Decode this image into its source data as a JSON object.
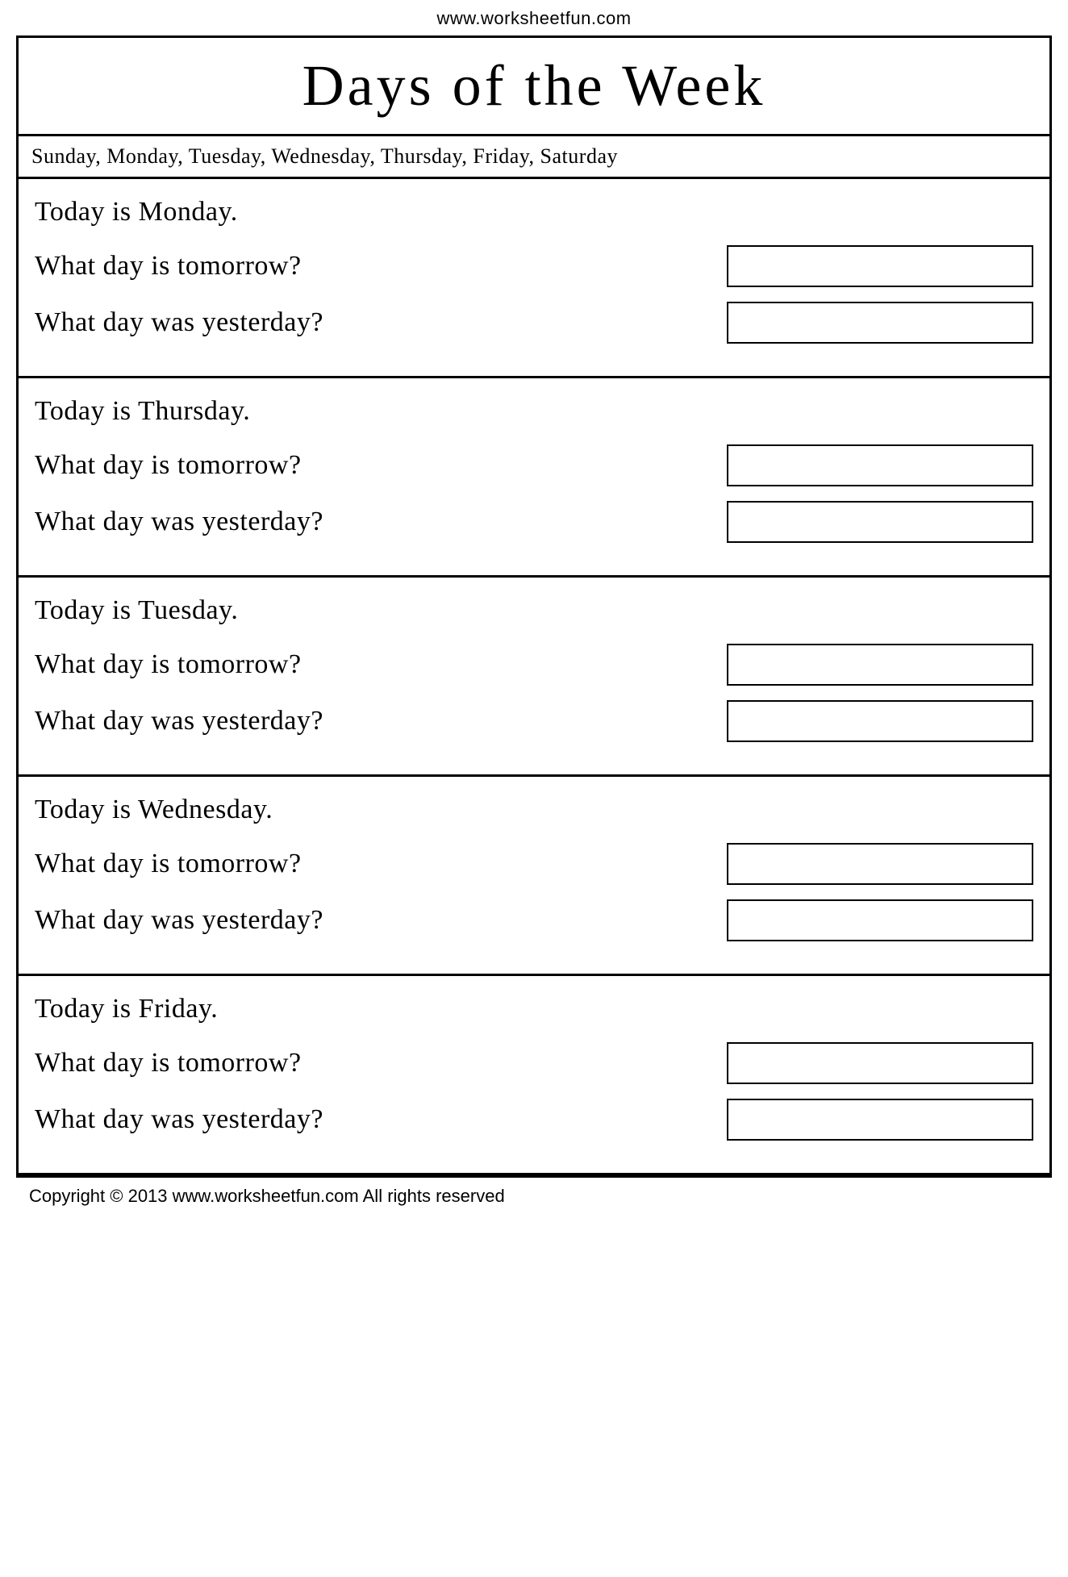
{
  "website": {
    "url": "www.worksheetfun.com"
  },
  "title": "Days of the Week",
  "days_list": "Sunday, Monday, Tuesday, Wednesday, Thursday, Friday, Saturday",
  "exercises": [
    {
      "today_statement": "Today is Monday.",
      "questions": [
        {
          "text": "What day is tomorrow?"
        },
        {
          "text": "What day was yesterday?"
        }
      ]
    },
    {
      "today_statement": "Today is Thursday.",
      "questions": [
        {
          "text": "What day is tomorrow?"
        },
        {
          "text": "What day was yesterday?"
        }
      ]
    },
    {
      "today_statement": "Today is Tuesday.",
      "questions": [
        {
          "text": "What day is tomorrow?"
        },
        {
          "text": "What day was yesterday?"
        }
      ]
    },
    {
      "today_statement": "Today is Wednesday.",
      "questions": [
        {
          "text": "What day is tomorrow?"
        },
        {
          "text": "What day was yesterday?"
        }
      ]
    },
    {
      "today_statement": "Today is Friday.",
      "questions": [
        {
          "text": "What day is tomorrow?"
        },
        {
          "text": "What day was yesterday?"
        }
      ]
    }
  ],
  "copyright": "Copyright © 2013 www.worksheetfun.com All rights reserved"
}
